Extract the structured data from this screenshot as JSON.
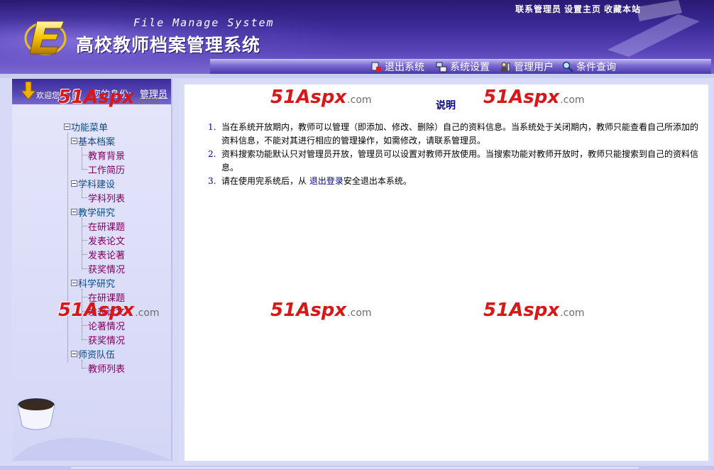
{
  "header": {
    "top_links": [
      "联系管理员",
      "设置主页",
      "收藏本站"
    ],
    "subtitle": "File Manage System",
    "title": "高校教师档案管理系统",
    "nav": [
      {
        "label": "退出系统",
        "icon": "logout-icon"
      },
      {
        "label": "系统设置",
        "icon": "settings-icon"
      },
      {
        "label": "管理用户",
        "icon": "users-icon"
      },
      {
        "label": "条件查询",
        "icon": "search-icon"
      }
    ]
  },
  "welcome": {
    "greeting": "欢迎您,",
    "greeting_tail": "回",
    "identity_label": "您的身份:",
    "identity_value": "管理员"
  },
  "menu": {
    "root": "功能菜单",
    "groups": [
      {
        "label": "基本档案",
        "items": [
          "教育背景",
          "工作简历"
        ]
      },
      {
        "label": "学科建设",
        "items": [
          "学科列表"
        ]
      },
      {
        "label": "教学研究",
        "items": [
          "在研课题",
          "发表论文",
          "发表论著",
          "获奖情况"
        ]
      },
      {
        "label": "科学研究",
        "items": [
          "在研课题",
          "发表论文",
          "论著情况",
          "获奖情况"
        ]
      },
      {
        "label": "师资队伍",
        "items": [
          "教师列表"
        ]
      }
    ]
  },
  "content": {
    "title": "说明",
    "notes": [
      {
        "num": "1.",
        "text": "当在系统开放期内，教师可以管理（即添加、修改、删除）自己的资料信息。当系统处于关闭期内，教师只能查看自己所添加的资料信息，不能对其进行相应的管理操作，如需修改，请联系管理员。"
      },
      {
        "num": "2.",
        "text": "资料搜索功能默认只对管理员开放，管理员可以设置对教师开放使用。当搜索功能对教师开放时，教师只能搜索到自己的资料信息。"
      },
      {
        "num": "3.",
        "pre": "请在使用完系统后，从 ",
        "link": "退出登录",
        "post": "安全退出本系统。"
      }
    ]
  },
  "watermark": {
    "main": "51",
    "brand": "Aspx",
    "tld": ".com"
  },
  "colors": {
    "accent": "#3c2a98",
    "link": "#00008b",
    "menu_leaf": "#800060",
    "watermark": "#d81818"
  }
}
